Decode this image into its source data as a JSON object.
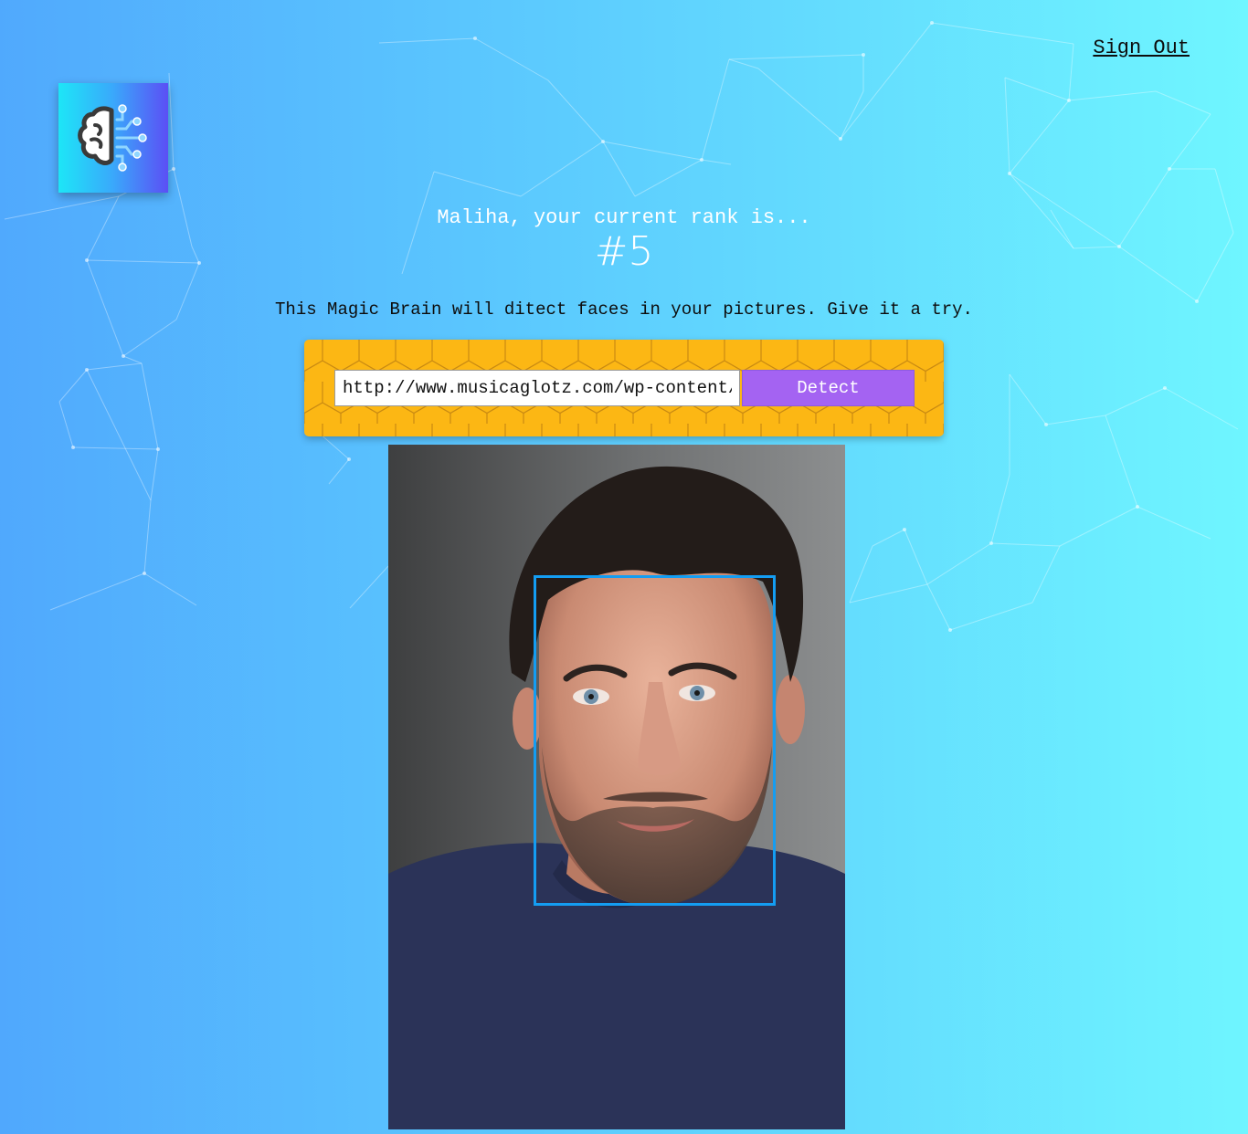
{
  "nav": {
    "sign_out_label": "Sign Out"
  },
  "logo": {
    "icon": "brain-circuit-icon"
  },
  "rank": {
    "message": "Maliha, your current rank is...",
    "value": "#5"
  },
  "intro_text": "This Magic Brain will ditect faces in your pictures. Give it a try.",
  "image_form": {
    "url_value": "http://www.musicaglotz.com/wp-content/uploads/",
    "detect_label": "Detect"
  },
  "result": {
    "image_description": "portrait-photo",
    "face_box_color": "#149df2"
  },
  "colors": {
    "background_start": "#50a8fd",
    "background_end": "#6ff6ff",
    "panel": "#fcb714",
    "detect_button": "#a463f2"
  }
}
